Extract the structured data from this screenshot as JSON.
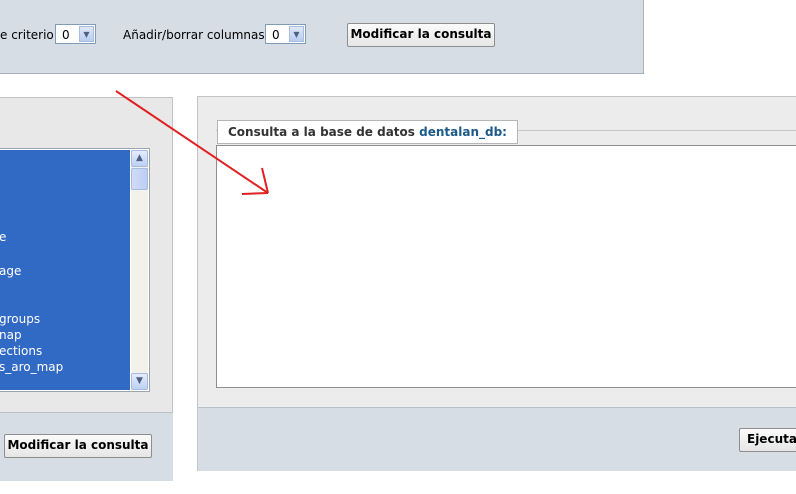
{
  "criteria_panel": {
    "criteria_label": "e criterio:",
    "criteria_value": "0",
    "columns_label": "Añadir/borrar columnas:",
    "columns_value": "0",
    "modify_button": "Modificar la consulta"
  },
  "table_list": {
    "items": [
      "e",
      "age",
      "groups",
      "nap",
      "ections",
      "s_aro_map"
    ],
    "modify_button": "Modificar la consulta"
  },
  "query_panel": {
    "legend_prefix": "Consulta a la base de datos",
    "database": "dentalan_db",
    "legend_suffix": ":",
    "query_text": "",
    "execute_button": "Ejecuta"
  },
  "colors": {
    "panel_bg": "#d6dde5",
    "selection_blue": "#316ac5",
    "annotation_arrow": "#e02020",
    "db_name": "#1c5a8a"
  },
  "icons": [
    "dropdown-arrow-icon",
    "scroll-up-icon",
    "scroll-down-icon",
    "annotation-arrow"
  ]
}
